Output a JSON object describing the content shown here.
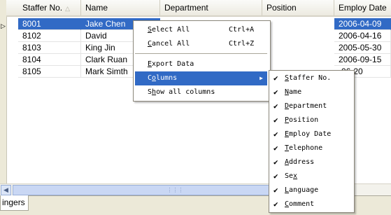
{
  "grid": {
    "columns": [
      {
        "label": "Staffer No.",
        "sort": "ascending"
      },
      {
        "label": "Name"
      },
      {
        "label": "Department"
      },
      {
        "label": "Position"
      },
      {
        "label": "Employ Date"
      }
    ],
    "rows": [
      {
        "no": "8001",
        "name": "Jake Chen",
        "date": "2006-04-09",
        "selected": true
      },
      {
        "no": "8102",
        "name": "David",
        "date": "2006-04-16"
      },
      {
        "no": "8103",
        "name": "King Jin",
        "date": "2005-05-30"
      },
      {
        "no": "8104",
        "name": "Clark Ruan",
        "date": "2006-09-15"
      },
      {
        "no": "8105",
        "name": "Mark Simth",
        "date": "-06-20"
      }
    ]
  },
  "tab": {
    "label": "ingers"
  },
  "context_menu": {
    "select_all": {
      "pre": "",
      "key": "S",
      "post": "elect All",
      "shortcut": "Ctrl+A"
    },
    "cancel_all": {
      "pre": "",
      "key": "C",
      "post": "ancel All",
      "shortcut": "Ctrl+Z"
    },
    "export_data": {
      "pre": "",
      "key": "E",
      "post": "xport Data"
    },
    "columns": {
      "pre": "C",
      "key": "o",
      "post": "lumns"
    },
    "show_all": {
      "pre": "S",
      "key": "h",
      "post": "ow all columns"
    }
  },
  "columns_submenu": [
    {
      "pre": "",
      "key": "S",
      "post": "taffer No.",
      "checked": true
    },
    {
      "pre": "",
      "key": "N",
      "post": "ame",
      "checked": true
    },
    {
      "pre": "",
      "key": "D",
      "post": "epartment",
      "checked": true
    },
    {
      "pre": "",
      "key": "P",
      "post": "osition",
      "checked": true
    },
    {
      "pre": "",
      "key": "E",
      "post": "mploy Date",
      "checked": true
    },
    {
      "pre": "",
      "key": "T",
      "post": "elephone",
      "checked": true
    },
    {
      "pre": "",
      "key": "A",
      "post": "ddress",
      "checked": true
    },
    {
      "pre": "Se",
      "key": "x",
      "post": "",
      "checked": true
    },
    {
      "pre": "",
      "key": "L",
      "post": "anguage",
      "checked": true
    },
    {
      "pre": "",
      "key": "C",
      "post": "omment",
      "checked": true
    }
  ],
  "icons": {
    "check": "checkmark-icon",
    "submenu": "triangle-right-icon",
    "sort": "sort-ascending-icon",
    "row_pointer": "row-pointer-icon"
  },
  "colors": {
    "selection": "#316ac5",
    "menu_border": "#8a867a"
  }
}
